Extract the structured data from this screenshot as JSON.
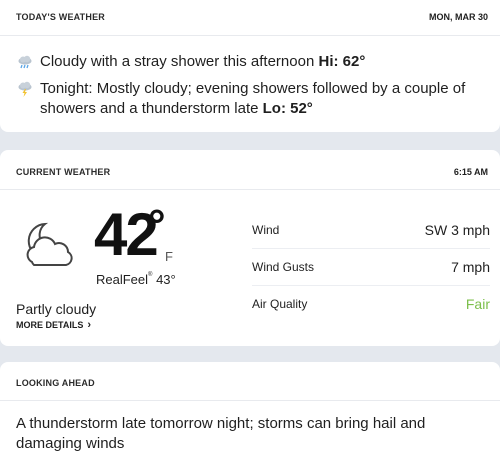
{
  "today": {
    "title": "TODAY'S WEATHER",
    "date": "MON, MAR 30",
    "day": {
      "icon": "cloudy-shower-icon",
      "text": "Cloudy with a stray shower this afternoon",
      "hilo_label": "Hi:",
      "hilo_value": "62°"
    },
    "night": {
      "icon": "thunderstorm-icon",
      "text": "Tonight: Mostly cloudy; evening showers followed by a couple of showers and a thunderstorm late",
      "hilo_label": "Lo:",
      "hilo_value": "52°"
    }
  },
  "current": {
    "title": "CURRENT WEATHER",
    "time": "6:15 AM",
    "icon": "partly-cloudy-night-icon",
    "temp": "42",
    "degree": "°",
    "unit": "F",
    "realfeel_label": "RealFeel",
    "realfeel_tm": "®",
    "realfeel_value": "43°",
    "phrase": "Partly cloudy",
    "more_details": "MORE DETAILS",
    "details": [
      {
        "label": "Wind",
        "value": "SW 3 mph",
        "color": "#1f1f1f"
      },
      {
        "label": "Wind Gusts",
        "value": "7 mph",
        "color": "#1f1f1f"
      },
      {
        "label": "Air Quality",
        "value": "Fair",
        "color": "#7cbf4b"
      }
    ]
  },
  "ahead": {
    "title": "LOOKING AHEAD",
    "text": "A thunderstorm late tomorrow night; storms can bring hail and damaging winds"
  }
}
